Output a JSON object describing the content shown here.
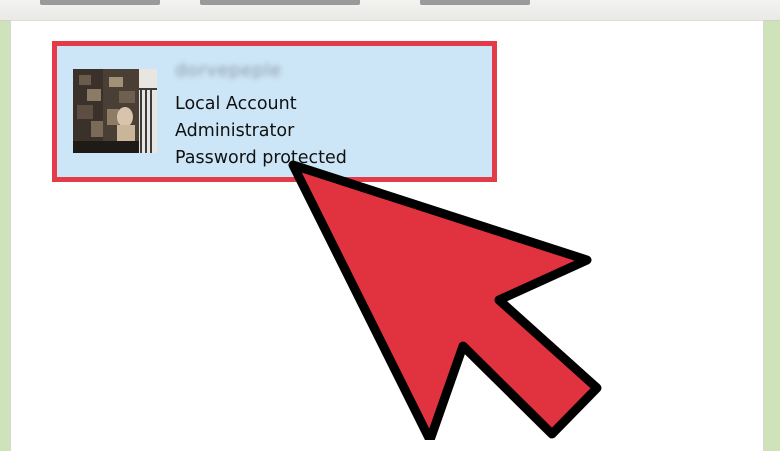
{
  "account": {
    "name": "dorvepeple",
    "type": "Local Account",
    "role": "Administrator",
    "security": "Password protected"
  },
  "colors": {
    "highlight_border": "#e33c48",
    "tile_background": "#cde6f7",
    "arrow_fill": "#e0323f",
    "arrow_outline": "#000000"
  },
  "icons": {
    "avatar": "user-photo",
    "pointer": "red-arrow-annotation"
  }
}
